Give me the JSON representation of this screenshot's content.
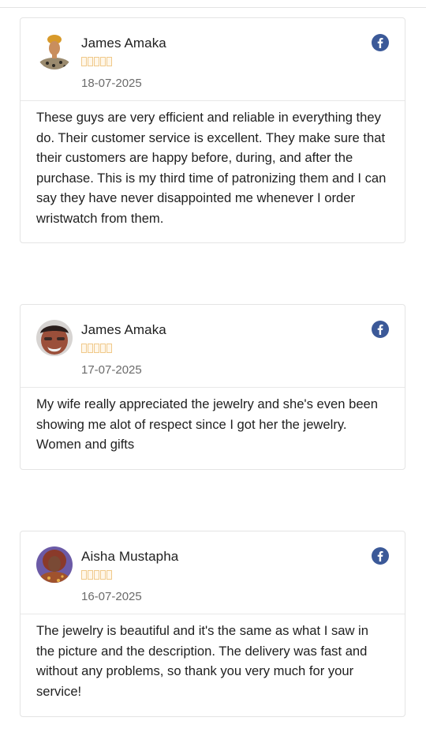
{
  "reviews": [
    {
      "name": "James Amaka",
      "rating": 5,
      "date": "18-07-2025",
      "source_icon": "facebook-icon",
      "text": "These guys are very efficient and reliable in everything they do. Their customer service is excellent. They make sure that their customers are happy before, during, and after the purchase. This is my third time of patronizing them and I can say they have never disappointed me whenever I order wristwatch from them."
    },
    {
      "name": "James Amaka",
      "rating": 5,
      "date": "17-07-2025",
      "source_icon": "facebook-icon",
      "text": "My wife really appreciated the jewelry and she's even been showing me alot of respect since I got her the jewelry. Women and gifts"
    },
    {
      "name": "Aisha Mustapha",
      "rating": 5,
      "date": "16-07-2025",
      "source_icon": "facebook-icon",
      "text": "The jewelry is beautiful and it's the same as what I saw in the picture and the description. The delivery was fast and without any problems, so thank you very much for your service!"
    }
  ],
  "colors": {
    "facebook": "#3b5998",
    "star_outline": "#f0c98a",
    "border": "#e4e4e4",
    "date_text": "#6b6b6b"
  }
}
